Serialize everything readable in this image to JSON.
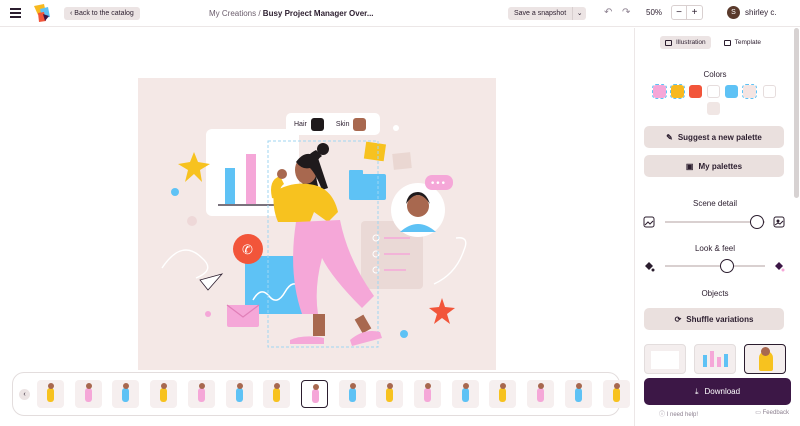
{
  "header": {
    "back_label": "Back to the catalog",
    "breadcrumb_parent": "My Creations",
    "breadcrumb_separator": " / ",
    "breadcrumb_current": "Busy Project Manager Over...",
    "snapshot_label": "Save a snapshot",
    "zoom_value": "50%",
    "zoom_minus": "−",
    "zoom_plus": "+",
    "avatar_initial": "S",
    "username": "shirley c."
  },
  "canvas": {
    "hair_label": "Hair",
    "skin_label": "Skin",
    "hair_color": "#1f1a1c",
    "skin_color": "#a8684f"
  },
  "panel": {
    "tabs": [
      {
        "label": "Illustration",
        "active": true
      },
      {
        "label": "Template",
        "active": false
      }
    ],
    "colors_title": "Colors",
    "colors": [
      "#f5a7d8",
      "#f7b91f",
      "#f2553a",
      "#ffffff",
      "#5ec2f5",
      "#f4e4e2",
      "#ffffff",
      "#f0e6e4"
    ],
    "suggest_label": "Suggest a new palette",
    "palettes_label": "My palettes",
    "scene_detail_title": "Scene detail",
    "scene_detail_level": 0.92,
    "look_feel_title": "Look & feel",
    "look_feel_level": 0.62,
    "objects_title": "Objects",
    "shuffle_label": "Shuffle variations",
    "download_label": "Download",
    "help_label": "I need help!",
    "feedback_label": "Feedback"
  },
  "carousel": {
    "count": 16,
    "selected_index": 7
  }
}
